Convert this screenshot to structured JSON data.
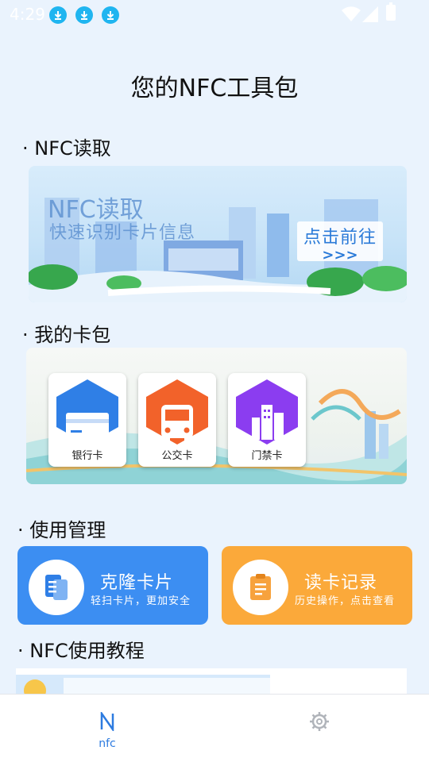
{
  "status_bar": {
    "time": "4:29",
    "icons": [
      "download-icon",
      "download-icon",
      "download-icon",
      "wifi-icon",
      "signal-icon",
      "battery-icon"
    ]
  },
  "page_title": "您的NFC工具包",
  "sections": {
    "nfc_read": "· NFC读取",
    "wallet": "· 我的卡包",
    "management": "· 使用管理",
    "tutorial": "· NFC使用教程"
  },
  "nfc_banner": {
    "title": "NFC读取",
    "subtitle": "快速识别卡片信息",
    "go_label": "点击前往",
    "go_arrows": ">>>"
  },
  "wallet_cards": [
    {
      "label": "银行卡",
      "icon": "bank-card-icon",
      "color": "#2f7fe6"
    },
    {
      "label": "公交卡",
      "icon": "bus-icon",
      "color": "#f2622a"
    },
    {
      "label": "门禁卡",
      "icon": "building-icon",
      "color": "#8b3df0"
    }
  ],
  "management": [
    {
      "title": "克隆卡片",
      "subtitle": "轻扫卡片，更加安全",
      "icon": "clone-card-icon",
      "color": "#3c8ef2"
    },
    {
      "title": "读卡记录",
      "subtitle": "历史操作，点击查看",
      "icon": "record-icon",
      "color": "#fba93a"
    }
  ],
  "bottom_nav": {
    "items": [
      {
        "label": "nfc",
        "icon": "nfc-icon",
        "active": true
      },
      {
        "label": "",
        "icon": "gear-icon",
        "active": false
      }
    ]
  },
  "colors": {
    "accent": "#2d7be0",
    "background": "#eaf3fd"
  }
}
